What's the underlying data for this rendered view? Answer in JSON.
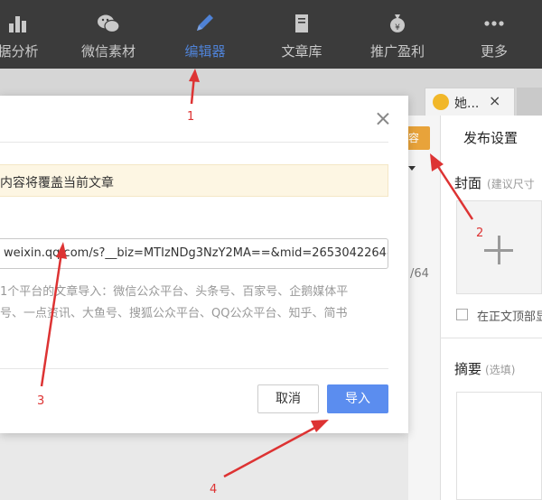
{
  "nav": {
    "items": [
      {
        "label": "据分析",
        "icon": "bar-chart-icon",
        "active": false
      },
      {
        "label": "微信素材",
        "icon": "wechat-icon",
        "active": false
      },
      {
        "label": "编辑器",
        "icon": "pencil-icon",
        "active": true
      },
      {
        "label": "文章库",
        "icon": "book-icon",
        "active": false
      },
      {
        "label": "推广盈利",
        "icon": "money-bag-icon",
        "active": false
      },
      {
        "label": "更多",
        "icon": "more-dots-icon",
        "active": false
      }
    ]
  },
  "tabs": {
    "current_label": "她...",
    "close": "×"
  },
  "dialog": {
    "notice": "内容将覆盖当前文章",
    "url_value": "weixin.qq.com/s?__biz=MTIzNDg3NzY2MA==&mid=2653042264&",
    "description_line1": "1个平台的文章导入：微信公众平台、头条号、百家号、企鹅媒体平",
    "description_line2": "号、一点资讯、大鱼号、搜狐公众平台、QQ公众平台、知乎、简书",
    "cancel_label": "取消",
    "import_label": "导入"
  },
  "side_panel": {
    "orange_button": "容",
    "publish_settings": "发布设置",
    "cover_label": "封面",
    "cover_hint": "(建议尺寸",
    "top_checkbox_label": "在正文顶部显",
    "summary_label": "摘要",
    "summary_hint": "(选填)",
    "char_count": "/64"
  },
  "annotations": [
    "1",
    "2",
    "3",
    "4"
  ],
  "colors": {
    "nav_bg": "#3b3b3b",
    "nav_active": "#4f82d6",
    "primary_button": "#5b8def",
    "annotation_red": "#dd3333",
    "notice_bg": "#fdf6e3"
  }
}
